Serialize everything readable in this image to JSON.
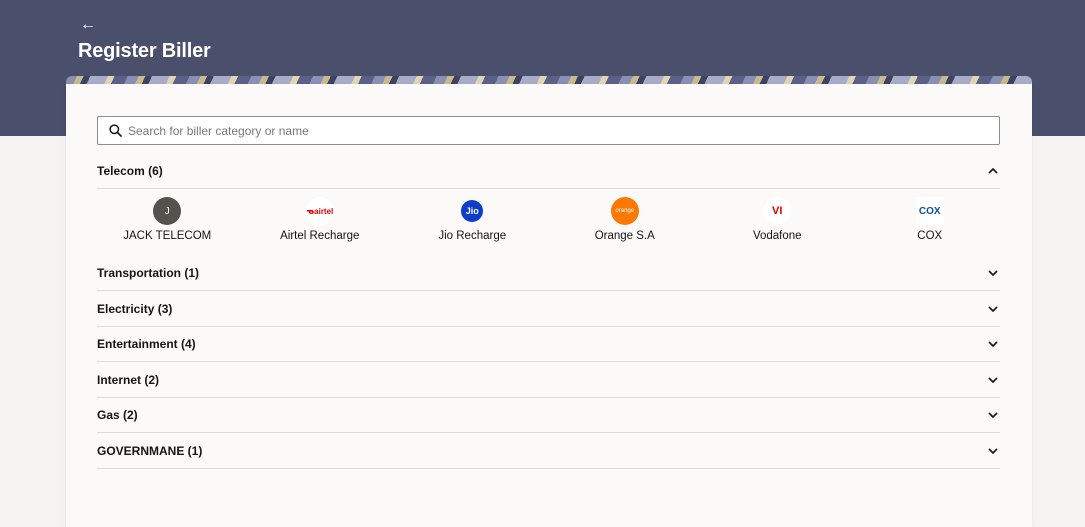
{
  "header": {
    "back_label": "←",
    "title": "Register Biller"
  },
  "search": {
    "placeholder": "Search for biller category or name",
    "icon": "search-icon"
  },
  "categories": [
    {
      "label": "Telecom (6)",
      "expanded": true,
      "billers": [
        {
          "name": "JACK TELECOM",
          "logo_text": "J",
          "logo_bg": "#55514c",
          "logo_fg": "#ffffff"
        },
        {
          "name": "Airtel Recharge",
          "logo_text": "airtel",
          "logo_bg": "#ffffff",
          "logo_fg": "#e40000"
        },
        {
          "name": "Jio Recharge",
          "logo_text": "Jio",
          "logo_bg": "#0f3cc9",
          "logo_fg": "#ffffff"
        },
        {
          "name": "Orange S.A",
          "logo_text": "orange",
          "logo_bg": "#ff7900",
          "logo_fg": "#ffffff"
        },
        {
          "name": "Vodafone",
          "logo_text": "VI",
          "logo_bg": "#ffffff",
          "logo_fg": "#e60000"
        },
        {
          "name": "COX",
          "logo_text": "COX",
          "logo_bg": "#ffffff",
          "logo_fg": "#0c4da2"
        }
      ]
    },
    {
      "label": "Transportation (1)",
      "expanded": false
    },
    {
      "label": "Electricity (3)",
      "expanded": false
    },
    {
      "label": "Entertainment (4)",
      "expanded": false
    },
    {
      "label": "Internet (2)",
      "expanded": false
    },
    {
      "label": "Gas (2)",
      "expanded": false
    },
    {
      "label": "GOVERNMANE (1)",
      "expanded": false
    }
  ],
  "colors": {
    "header_bg": "#4a4f6b",
    "page_bg": "#f4f3f1",
    "card_bg": "#fbfaf9",
    "divider": "#dedcd8"
  }
}
